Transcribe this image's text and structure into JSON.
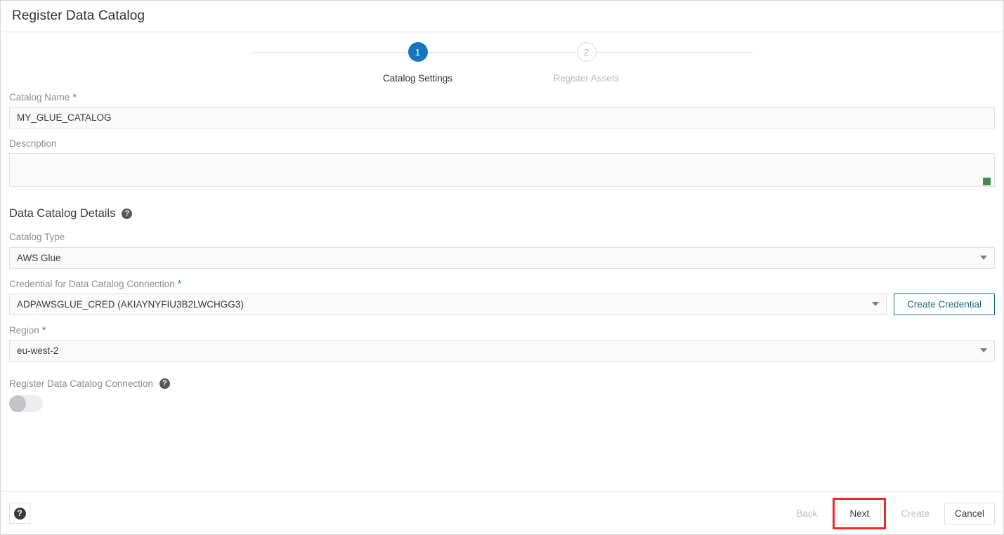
{
  "window": {
    "title": "Register Data Catalog"
  },
  "stepper": {
    "steps": [
      {
        "number": "1",
        "label": "Catalog Settings",
        "state": "active"
      },
      {
        "number": "2",
        "label": "Register Assets",
        "state": "inactive"
      }
    ]
  },
  "form": {
    "catalog_name": {
      "label": "Catalog Name",
      "required_marker": "*",
      "value": "MY_GLUE_CATALOG",
      "placeholder": ""
    },
    "description": {
      "label": "Description",
      "value": "",
      "placeholder": ""
    },
    "section": {
      "title": "Data Catalog Details",
      "help_icon": "help-icon",
      "help_glyph": "?"
    },
    "catalog_type": {
      "label": "Catalog Type",
      "value": "AWS Glue"
    },
    "credential": {
      "label": "Credential for Data Catalog Connection",
      "required_marker": "*",
      "value": "ADPAWSGLUE_CRED (AKIAYNYFIU3B2LWCHGG3)",
      "button_label": "Create Credential"
    },
    "region": {
      "label": "Region",
      "required_marker": "*",
      "value": "eu-west-2"
    },
    "register_connection": {
      "label": "Register Data Catalog Connection",
      "help_glyph": "?",
      "toggle_state": "off"
    }
  },
  "footer": {
    "help_glyph": "?",
    "buttons": [
      {
        "label": "Back",
        "state": "disabled",
        "highlighted": false
      },
      {
        "label": "Next",
        "state": "enabled",
        "highlighted": true
      },
      {
        "label": "Create",
        "state": "disabled",
        "highlighted": false
      },
      {
        "label": "Cancel",
        "state": "enabled",
        "highlighted": false
      }
    ]
  },
  "colors": {
    "accent_blue": "#1776bb",
    "teal_button": "#1b6b80",
    "highlight_red": "#ec2b2b",
    "resize_handle_green": "#3d8f51",
    "required_star": "#5584ad"
  }
}
